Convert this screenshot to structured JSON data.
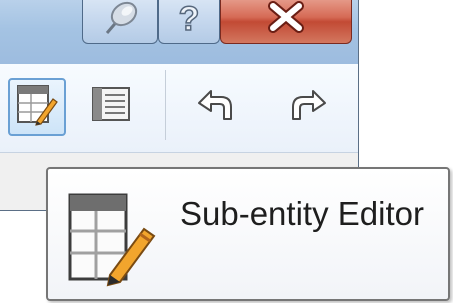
{
  "tooltip": {
    "title": "Sub-entity Editor",
    "icon": "sub-entity-editor-icon"
  },
  "caption_buttons": {
    "pin": "pin-icon",
    "help": "?",
    "close": "close-icon"
  },
  "toolbar": {
    "buttons": [
      {
        "icon": "sub-entity-editor-icon",
        "active": true
      },
      {
        "icon": "form-view-icon",
        "active": false
      },
      {
        "icon": "undo-arrow-icon",
        "active": false
      },
      {
        "icon": "redo-arrow-icon",
        "active": false
      }
    ]
  },
  "colors": {
    "titlebar": "#a4c3e3",
    "close_button": "#c24a34",
    "active_button_border": "#6aa0d4",
    "pencil": "#f2a52d"
  }
}
